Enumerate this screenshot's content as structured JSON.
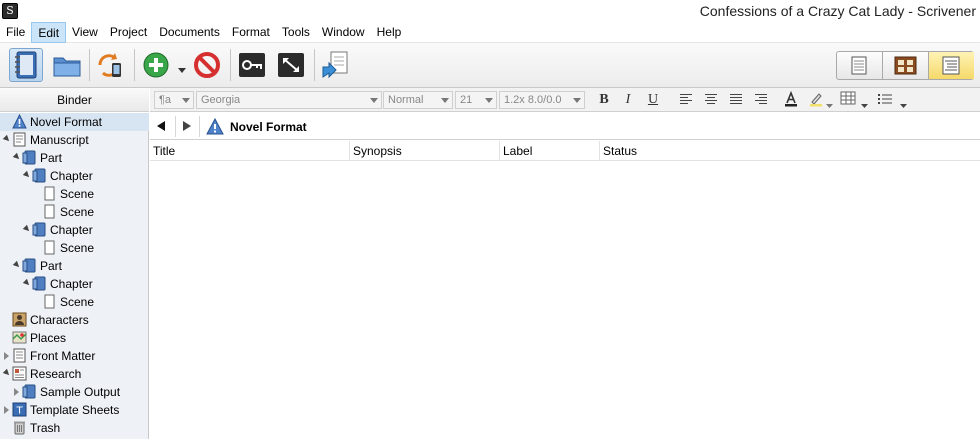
{
  "window": {
    "title": "Confessions of a Crazy Cat Lady - Scrivener",
    "app_icon": "S"
  },
  "menu": [
    "File",
    "Edit",
    "View",
    "Project",
    "Documents",
    "Format",
    "Tools",
    "Window",
    "Help"
  ],
  "menu_active": "Edit",
  "toolbar": {
    "icons": [
      "binder-toggle-icon",
      "collections-icon",
      "sync-icon",
      "add-icon",
      "delete-icon",
      "keywords-icon",
      "fullscreen-icon",
      "compile-icon"
    ],
    "view_modes": [
      "scrivenings-icon",
      "corkboard-icon",
      "outliner-icon"
    ],
    "active_view": "outliner-icon"
  },
  "format_bar": {
    "paragraph_style": "¶a",
    "font": "Georgia",
    "typeface": "Normal",
    "size": "21",
    "line_spacing": "1.2x 8.0/0.0"
  },
  "binder": {
    "header": "Binder",
    "items": [
      {
        "label": "Novel Format",
        "icon": "warning-icon",
        "depth": 0,
        "expander": "none",
        "selected": true
      },
      {
        "label": "Manuscript",
        "icon": "manuscript-icon",
        "depth": 0,
        "expander": "open"
      },
      {
        "label": "Part",
        "icon": "folder-icon",
        "depth": 1,
        "expander": "open"
      },
      {
        "label": "Chapter",
        "icon": "folder-icon",
        "depth": 2,
        "expander": "open"
      },
      {
        "label": "Scene",
        "icon": "document-icon",
        "depth": 3,
        "expander": "none"
      },
      {
        "label": "Scene",
        "icon": "document-icon",
        "depth": 3,
        "expander": "none"
      },
      {
        "label": "Chapter",
        "icon": "folder-icon",
        "depth": 2,
        "expander": "open"
      },
      {
        "label": "Scene",
        "icon": "document-icon",
        "depth": 3,
        "expander": "none"
      },
      {
        "label": "Part",
        "icon": "folder-icon",
        "depth": 1,
        "expander": "open"
      },
      {
        "label": "Chapter",
        "icon": "folder-icon",
        "depth": 2,
        "expander": "open"
      },
      {
        "label": "Scene",
        "icon": "document-icon",
        "depth": 3,
        "expander": "none"
      },
      {
        "label": "Characters",
        "icon": "character-sheet-icon",
        "depth": 0,
        "expander": "none"
      },
      {
        "label": "Places",
        "icon": "places-icon",
        "depth": 0,
        "expander": "none"
      },
      {
        "label": "Front Matter",
        "icon": "front-matter-icon",
        "depth": 0,
        "expander": "closed"
      },
      {
        "label": "Research",
        "icon": "research-icon",
        "depth": 0,
        "expander": "open"
      },
      {
        "label": "Sample Output",
        "icon": "folder-icon",
        "depth": 1,
        "expander": "closed"
      },
      {
        "label": "Template Sheets",
        "icon": "template-sheets-icon",
        "depth": 0,
        "expander": "closed"
      },
      {
        "label": "Trash",
        "icon": "trash-icon",
        "depth": 0,
        "expander": "none"
      }
    ]
  },
  "editor": {
    "document_title": "Novel Format",
    "document_icon": "warning-icon",
    "columns": [
      "Title",
      "Synopsis",
      "Label",
      "Status"
    ]
  }
}
